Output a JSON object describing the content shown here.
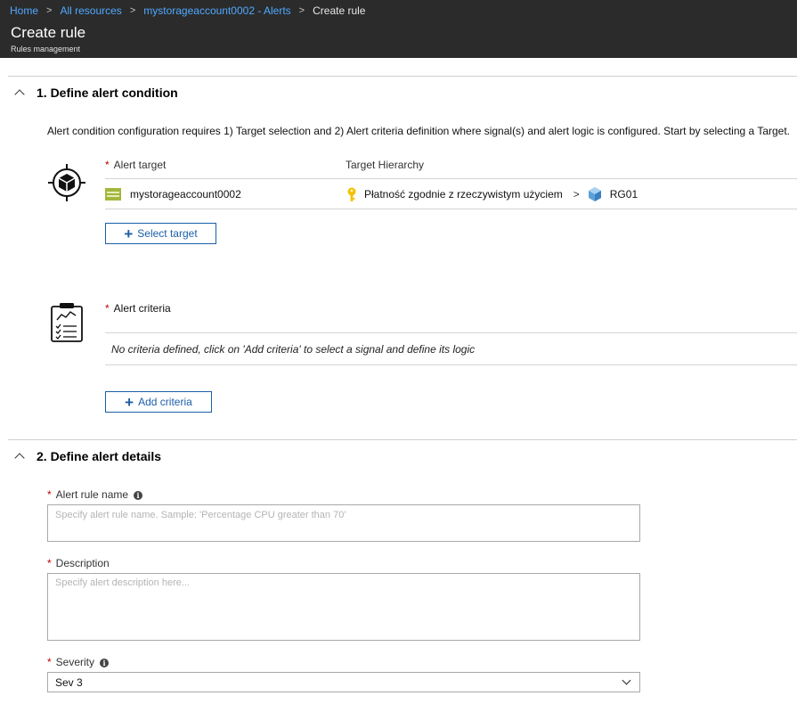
{
  "breadcrumb": {
    "items": [
      "Home",
      "All resources",
      "mystorageaccount0002 - Alerts"
    ],
    "current": "Create rule"
  },
  "header": {
    "title": "Create rule",
    "subtitle": "Rules management"
  },
  "section1": {
    "title": "1. Define alert condition",
    "description": "Alert condition configuration requires 1) Target selection and 2) Alert criteria definition where signal(s) and alert logic is configured. Start by selecting a Target.",
    "target_col_label": "Alert target",
    "hierarchy_col_label": "Target Hierarchy",
    "target_name": "mystorageaccount0002",
    "subscription": "Płatność zgodnie z rzeczywistym użyciem",
    "resource_group": "RG01",
    "select_target_label": "Select target",
    "criteria_label": "Alert criteria",
    "no_criteria_text": "No criteria defined, click on 'Add criteria' to select a signal and define its logic",
    "add_criteria_label": "Add criteria"
  },
  "section2": {
    "title": "2. Define alert details",
    "rule_name_label": "Alert rule name",
    "rule_name_placeholder": "Specify alert rule name. Sample: 'Percentage CPU greater than 70'",
    "description_label": "Description",
    "description_placeholder": "Specify alert description here...",
    "severity_label": "Severity",
    "severity_value": "Sev 3"
  },
  "icons": {
    "target": "crosshair-cube-icon",
    "storage": "storage-account-icon",
    "subscription": "key-icon",
    "resource_group": "resource-group-cube-icon",
    "criteria": "clipboard-checklist-icon",
    "info": "info-icon"
  },
  "colors": {
    "header_bg": "#2b2b2b",
    "link": "#4fa8ff",
    "accent": "#1b5fa8",
    "required": "#c00000"
  }
}
